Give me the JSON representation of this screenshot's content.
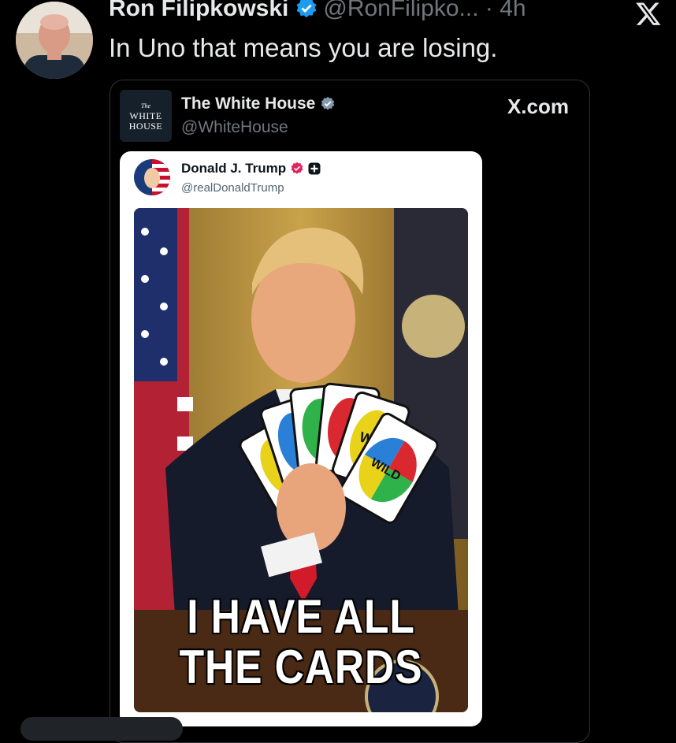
{
  "tweet": {
    "author_name": "Ron Filipkowski",
    "author_handle_time": "@RonFilipko... · 4h",
    "text": "In Uno that means you are losing."
  },
  "quoted": {
    "account_name": "The White House",
    "account_handle": "@WhiteHouse",
    "source": "X.com",
    "logo_small": "The",
    "logo_line1": "WHITE",
    "logo_line2": "HOUSE"
  },
  "embedded": {
    "name": "Donald J. Trump",
    "handle": "@realDonaldTrump",
    "caption_line1": "I HAVE ALL",
    "caption_line2": "THE CARDS",
    "card_label": "WILD",
    "card_letter": "W"
  },
  "colors": {
    "background": "#000000",
    "verified_blue": "#1d9bf0",
    "verified_pink": "#e0245e",
    "handle_gray": "#71767b"
  },
  "icons": [
    "verified-badge-icon",
    "x-logo-icon",
    "plus-badge-icon"
  ]
}
